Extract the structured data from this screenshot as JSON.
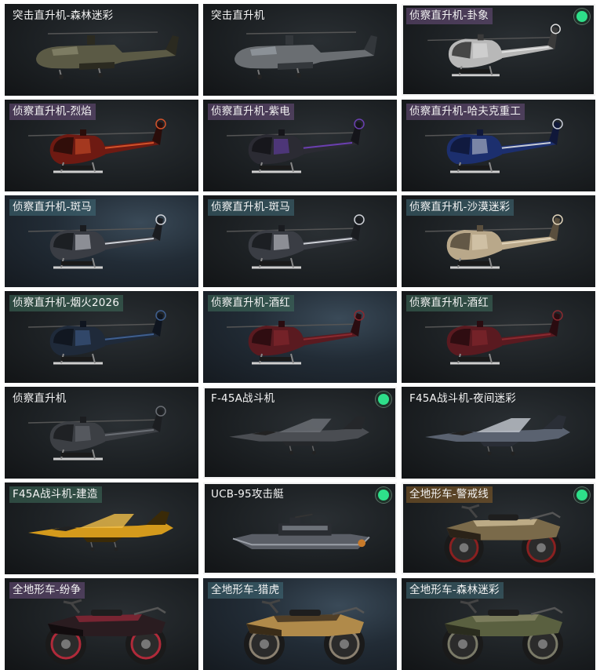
{
  "tiles": [
    {
      "label": "突击直升机-森林迷彩",
      "kind": "apache",
      "tag": "plain",
      "bg": "dark",
      "selected": false,
      "equipped": false,
      "colors": {
        "body": "#5b5a45",
        "accent": "#8b8a70",
        "dark": "#2b2a20"
      }
    },
    {
      "label": "突击直升机",
      "kind": "apache",
      "tag": "plain",
      "bg": "dark",
      "selected": false,
      "equipped": false,
      "colors": {
        "body": "#6a6e72",
        "accent": "#9aa0a6",
        "dark": "#33373b"
      }
    },
    {
      "label": "侦察直升机-卦象",
      "kind": "littlebird",
      "tag": "purple",
      "bg": "dark",
      "selected": true,
      "equipped": true,
      "colors": {
        "body": "#b8b8b8",
        "accent": "#e0e0e0",
        "dark": "#3a3a3a"
      }
    },
    {
      "label": "侦察直升机-烈焰",
      "kind": "littlebird",
      "tag": "purple",
      "bg": "dark",
      "selected": false,
      "equipped": false,
      "colors": {
        "body": "#6e1a12",
        "accent": "#d2522a",
        "dark": "#2a0d0a"
      }
    },
    {
      "label": "侦察直升机-紫电",
      "kind": "littlebird",
      "tag": "purple",
      "bg": "dark",
      "selected": false,
      "equipped": false,
      "colors": {
        "body": "#2b2b33",
        "accent": "#6a3fb0",
        "dark": "#15151a"
      }
    },
    {
      "label": "侦察直升机-哈夫克重工",
      "kind": "littlebird",
      "tag": "purple",
      "bg": "dark",
      "selected": false,
      "equipped": false,
      "colors": {
        "body": "#1c2f6e",
        "accent": "#c8ccd6",
        "dark": "#10183a"
      }
    },
    {
      "label": "侦察直升机-斑马",
      "kind": "littlebird",
      "tag": "blue",
      "bg": "blue",
      "selected": false,
      "equipped": false,
      "colors": {
        "body": "#3a3d44",
        "accent": "#cfd2d8",
        "dark": "#1a1c20"
      }
    },
    {
      "label": "侦察直升机-斑马",
      "kind": "littlebird",
      "tag": "blue",
      "bg": "dark",
      "selected": false,
      "equipped": false,
      "colors": {
        "body": "#3a3d44",
        "accent": "#cfd2d8",
        "dark": "#1a1c20"
      }
    },
    {
      "label": "侦察直升机-沙漠迷彩",
      "kind": "littlebird",
      "tag": "blue",
      "bg": "dark",
      "selected": false,
      "equipped": false,
      "colors": {
        "body": "#b9a88a",
        "accent": "#e1d4ba",
        "dark": "#5a4f3e"
      }
    },
    {
      "label": "侦察直升机-烟火2026",
      "kind": "littlebird",
      "tag": "green",
      "bg": "dark",
      "selected": false,
      "equipped": false,
      "colors": {
        "body": "#1f2a3a",
        "accent": "#3f5f8f",
        "dark": "#0f151f"
      }
    },
    {
      "label": "侦察直升机-酒红",
      "kind": "littlebird",
      "tag": "green",
      "bg": "blue",
      "selected": false,
      "equipped": false,
      "colors": {
        "body": "#5a1a20",
        "accent": "#8a2a30",
        "dark": "#2a0c10"
      }
    },
    {
      "label": "侦察直升机-酒红",
      "kind": "littlebird",
      "tag": "green",
      "bg": "dark",
      "selected": false,
      "equipped": false,
      "colors": {
        "body": "#5a1a20",
        "accent": "#8a2a30",
        "dark": "#2a0c10"
      }
    },
    {
      "label": "侦察直升机",
      "kind": "littlebird",
      "tag": "plain",
      "bg": "dark",
      "selected": false,
      "equipped": false,
      "colors": {
        "body": "#3c3f44",
        "accent": "#6a6e74",
        "dark": "#1c1e21"
      }
    },
    {
      "label": "F-45A战斗机",
      "kind": "jet",
      "tag": "plain",
      "bg": "dark",
      "selected": true,
      "equipped": true,
      "colors": {
        "body": "#4a4d52",
        "accent": "#6e7278",
        "dark": "#25272a"
      }
    },
    {
      "label": "F45A战斗机-夜间迷彩",
      "kind": "jet",
      "tag": "plain",
      "bg": "dark",
      "selected": false,
      "equipped": false,
      "colors": {
        "body": "#5a6270",
        "accent": "#c5cad2",
        "dark": "#2a2e36"
      }
    },
    {
      "label": "F45A战斗机-建造",
      "kind": "jet",
      "tag": "green",
      "bg": "dark",
      "selected": false,
      "equipped": false,
      "colors": {
        "body": "#d49a1c",
        "accent": "#f0be48",
        "dark": "#3a2a08"
      }
    },
    {
      "label": "UCB-95攻击艇",
      "kind": "boat",
      "tag": "plain",
      "bg": "dark",
      "selected": true,
      "equipped": true,
      "colors": {
        "body": "#5a5e66",
        "accent": "#9ba0a8",
        "dark": "#2a2d32"
      }
    },
    {
      "label": "全地形车-警戒线",
      "kind": "atv",
      "tag": "orange",
      "bg": "dark",
      "selected": true,
      "equipped": true,
      "colors": {
        "body": "#7a6a4a",
        "accent": "#d8c8a0",
        "dark": "#2a2218",
        "rim": "#8a2020"
      }
    },
    {
      "label": "全地形车-纷争",
      "kind": "atv",
      "tag": "purple",
      "bg": "dark",
      "selected": false,
      "equipped": false,
      "colors": {
        "body": "#2a1c20",
        "accent": "#9a2a3a",
        "dark": "#120c0e",
        "rim": "#b02a3a"
      }
    },
    {
      "label": "全地形车-猎虎",
      "kind": "atv",
      "tag": "blue",
      "bg": "blue",
      "selected": false,
      "equipped": false,
      "colors": {
        "body": "#b08a4a",
        "accent": "#2a2018",
        "dark": "#3a2c18",
        "rim": "#8a8070"
      }
    },
    {
      "label": "全地形车-森林迷彩",
      "kind": "atv",
      "tag": "blue",
      "bg": "dark",
      "selected": false,
      "equipped": false,
      "colors": {
        "body": "#5a6040",
        "accent": "#8a8a6a",
        "dark": "#2a2c1e",
        "rim": "#7a7a68"
      }
    }
  ]
}
